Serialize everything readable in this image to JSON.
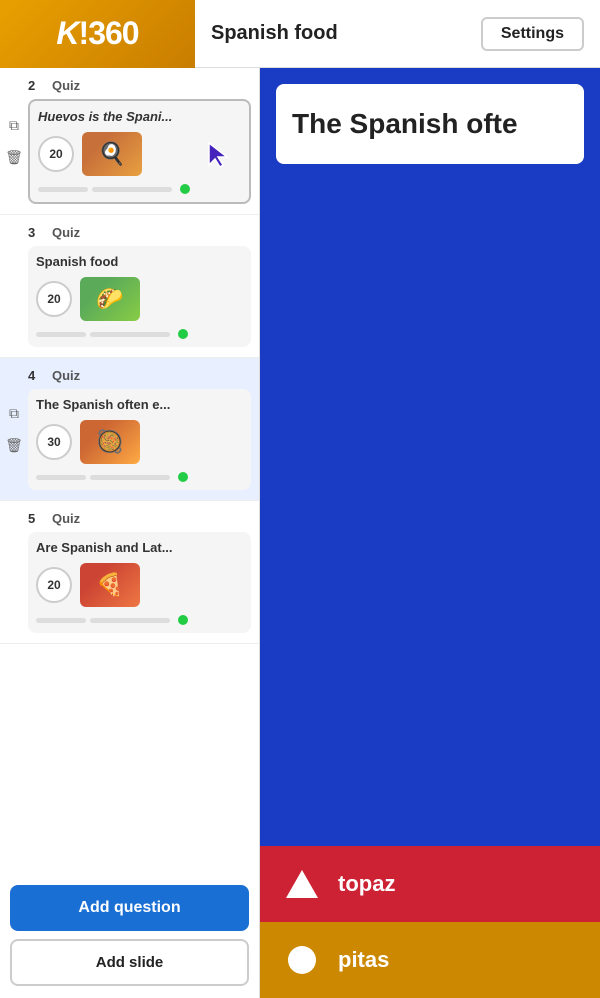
{
  "header": {
    "logo": "K!360",
    "title": "Spanish food",
    "settings_label": "Settings"
  },
  "sidebar": {
    "items": [
      {
        "number": "2",
        "type": "Quiz",
        "title": "Huevos is the Spani...",
        "title_italic": true,
        "points": "20",
        "thumbnail_class": "food1",
        "thumbnail_emoji": "🍳",
        "active": false,
        "selected": true,
        "has_cursor": true
      },
      {
        "number": "3",
        "type": "Quiz",
        "title": "Spanish food",
        "title_italic": false,
        "points": "20",
        "thumbnail_class": "food2",
        "thumbnail_emoji": "🌮",
        "active": false,
        "selected": false,
        "has_cursor": false
      },
      {
        "number": "4",
        "type": "Quiz",
        "title": "The Spanish often e...",
        "title_italic": false,
        "points": "30",
        "thumbnail_class": "food3",
        "thumbnail_emoji": "🥘",
        "active": true,
        "selected": false,
        "has_cursor": false
      },
      {
        "number": "5",
        "type": "Quiz",
        "title": "Are Spanish and Lat...",
        "title_italic": false,
        "points": "20",
        "thumbnail_class": "food4",
        "thumbnail_emoji": "🍕",
        "active": false,
        "selected": false,
        "has_cursor": false
      }
    ],
    "add_question_label": "Add question",
    "add_slide_label": "Add slide"
  },
  "main": {
    "question_text": "The Spanish ofte",
    "answers": [
      {
        "label": "topaz",
        "color_class": "answer-red",
        "icon": "triangle"
      },
      {
        "label": "pitas",
        "color_class": "answer-gold",
        "icon": "circle"
      }
    ]
  },
  "icons": {
    "copy": "⧉",
    "trash": "🗑",
    "copy2": "⧉",
    "trash2": "🗑"
  }
}
